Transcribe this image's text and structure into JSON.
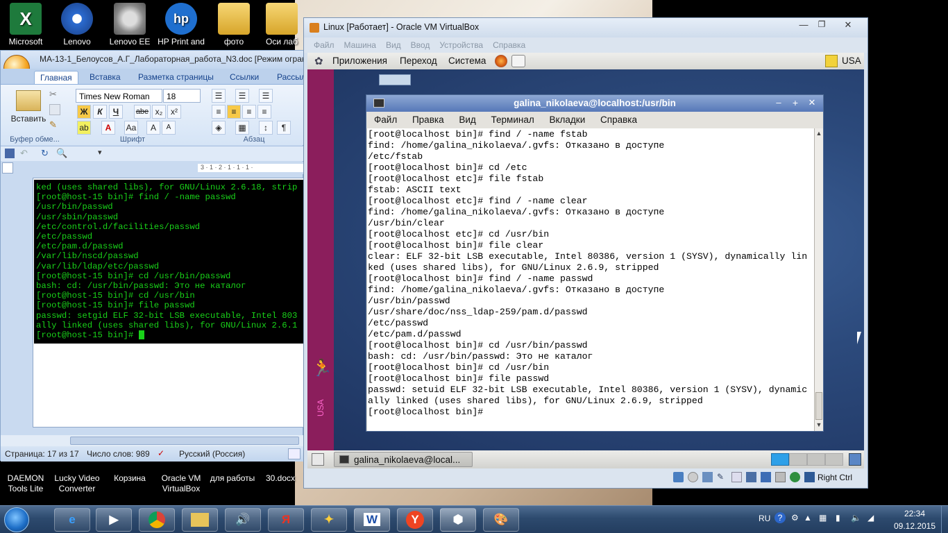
{
  "desktop": {
    "icons_top": [
      {
        "label": "Microsoft"
      },
      {
        "label": "Lenovo"
      },
      {
        "label": "Lenovo EE"
      },
      {
        "label": "HP Print and"
      },
      {
        "label": "фото"
      },
      {
        "label": "Оси лаб"
      }
    ],
    "icons_bottom": [
      {
        "label": "DAEMON Tools Lite"
      },
      {
        "label": "Lucky Video Converter"
      },
      {
        "label": "Корзина"
      },
      {
        "label": "Oracle VM VirtualBox"
      },
      {
        "label": "для работы"
      },
      {
        "label": "30.docx"
      }
    ]
  },
  "word": {
    "title": "МА-13-1_Белоусов_А.Г_Лабораторная_работа_N3.doc [Режим ограни",
    "tabs": [
      "Главная",
      "Вставка",
      "Разметка страницы",
      "Ссылки",
      "Рассыл"
    ],
    "paste_label": "Вставить",
    "font_name": "Times New Roman",
    "font_size": "18",
    "groups": [
      "Буфер обме...",
      "Шрифт",
      "Абзац"
    ],
    "bold": "Ж",
    "italic": "К",
    "underline": "Ч",
    "strike": "abe",
    "terminal_lines": [
      "ked (uses shared libs), for GNU/Linux 2.6.18, strip",
      "[root@host-15 bin]# find / -name passwd",
      "/usr/bin/passwd",
      "/usr/sbin/passwd",
      "/etc/control.d/facilities/passwd",
      "/etc/passwd",
      "/etc/pam.d/passwd",
      "/var/lib/nscd/passwd",
      "/var/lib/ldap/etc/passwd",
      "[root@host-15 bin]# cd /usr/bin/passwd",
      "bash: cd: /usr/bin/passwd: Это не каталог",
      "[root@host-15 bin]# cd /usr/bin",
      "[root@host-15 bin]# file passwd",
      "passwd: setgid ELF 32-bit LSB executable, Intel 803",
      "ally linked (uses shared libs), for GNU/Linux 2.6.1",
      "[root@host-15 bin]# "
    ],
    "status": {
      "page": "Страница: 17 из 17",
      "words": "Число слов: 989",
      "lang": "Русский (Россия)"
    }
  },
  "vbox": {
    "title": "Linux [Работает] - Oracle VM VirtualBox",
    "menu": [
      "Файл",
      "Машина",
      "Вид",
      "Ввод",
      "Устройства",
      "Справка"
    ],
    "guest_panel": {
      "items": [
        "Приложения",
        "Переход",
        "Система"
      ],
      "keyboard": "USA"
    },
    "usa_band": "USA",
    "taskbar_item": "galina_nikolaeva@local...",
    "host_key": "Right Ctrl"
  },
  "terminal": {
    "title": "galina_nikolaeva@localhost:/usr/bin",
    "menu": [
      "Файл",
      "Правка",
      "Вид",
      "Терминал",
      "Вкладки",
      "Справка"
    ],
    "lines": [
      "[root@localhost bin]# find / -name fstab",
      "find: /home/galina_nikolaeva/.gvfs: Отказано в доступе",
      "/etc/fstab",
      "[root@localhost bin]# cd /etc",
      "[root@localhost etc]# file fstab",
      "fstab: ASCII text",
      "[root@localhost etc]# find / -name clear",
      "find: /home/galina_nikolaeva/.gvfs: Отказано в доступе",
      "/usr/bin/clear",
      "[root@localhost etc]# cd /usr/bin",
      "[root@localhost bin]# file clear",
      "clear: ELF 32-bit LSB executable, Intel 80386, version 1 (SYSV), dynamically lin",
      "ked (uses shared libs), for GNU/Linux 2.6.9, stripped",
      "[root@localhost bin]# find / -name passwd",
      "find: /home/galina_nikolaeva/.gvfs: Отказано в доступе",
      "/usr/bin/passwd",
      "/usr/share/doc/nss_ldap-259/pam.d/passwd",
      "/etc/passwd",
      "/etc/pam.d/passwd",
      "[root@localhost bin]# cd /usr/bin/passwd",
      "bash: cd: /usr/bin/passwd: Это не каталог",
      "[root@localhost bin]# cd /usr/bin",
      "[root@localhost bin]# file passwd",
      "passwd: setuid ELF 32-bit LSB executable, Intel 80386, version 1 (SYSV), dynamic",
      "ally linked (uses shared libs), for GNU/Linux 2.6.9, stripped",
      "[root@localhost bin]#"
    ]
  },
  "taskbar": {
    "lang": "RU",
    "time": "22:34",
    "date": "09.12.2015"
  }
}
